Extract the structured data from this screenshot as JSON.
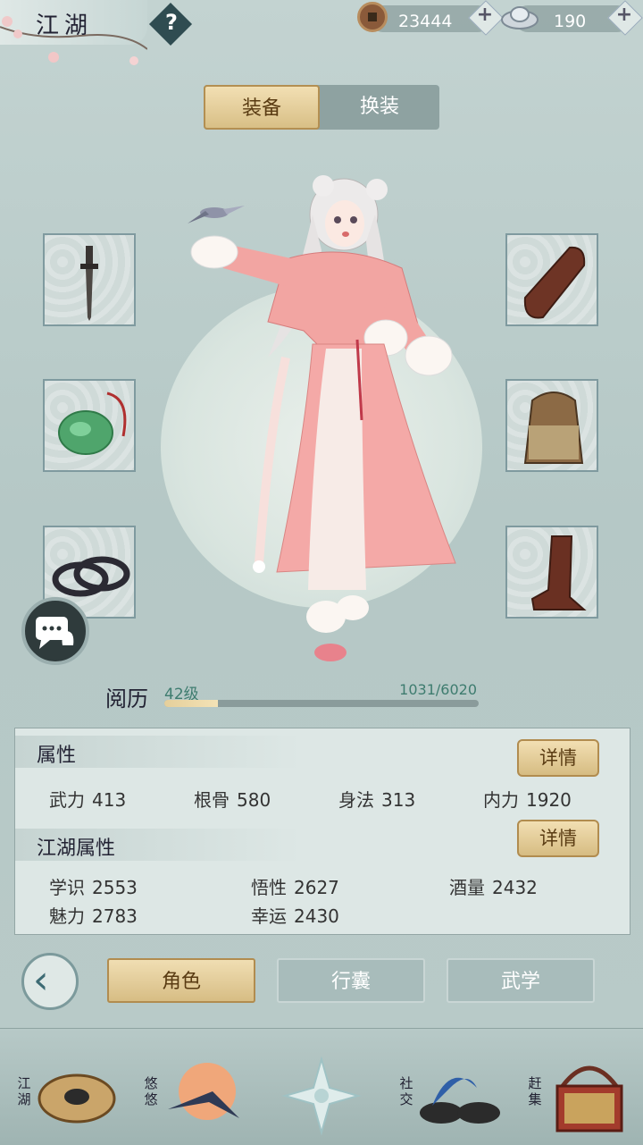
{
  "header": {
    "title": "江湖",
    "help_label": "?",
    "copper": "23444",
    "silver": "190",
    "plus_label": "+"
  },
  "tabs": [
    {
      "label": "装备"
    },
    {
      "label": "换装"
    }
  ],
  "equipment_icons": [
    "dagger-icon",
    "jade-pendant-icon",
    "bracelet-icon",
    "shoe-icon",
    "armor-icon",
    "boot-icon"
  ],
  "experience": {
    "label": "阅历",
    "level": "42级",
    "progress": "1031/6020",
    "fraction": 0.171
  },
  "attributes": {
    "title": "属性",
    "detail_label": "详情",
    "items": [
      {
        "name": "武力",
        "value": "413"
      },
      {
        "name": "根骨",
        "value": "580"
      },
      {
        "name": "身法",
        "value": "313"
      },
      {
        "name": "内力",
        "value": "1920"
      }
    ]
  },
  "jianghu_attributes": {
    "title": "江湖属性",
    "detail_label": "详情",
    "items": [
      {
        "name": "学识",
        "value": "2553"
      },
      {
        "name": "悟性",
        "value": "2627"
      },
      {
        "name": "酒量",
        "value": "2432"
      },
      {
        "name": "魅力",
        "value": "2783"
      },
      {
        "name": "幸运",
        "value": "2430"
      }
    ]
  },
  "bottom_buttons": [
    {
      "label": "角色"
    },
    {
      "label": "行囊"
    },
    {
      "label": "武学"
    }
  ],
  "nav": [
    {
      "label": "江湖"
    },
    {
      "label": "悠悠"
    },
    {
      "label": "社交"
    },
    {
      "label": "赶集"
    }
  ],
  "colors": {
    "accent_gold": "#d8bf86",
    "exp_text": "#3e7c6f",
    "background": "#b9cbc9"
  }
}
